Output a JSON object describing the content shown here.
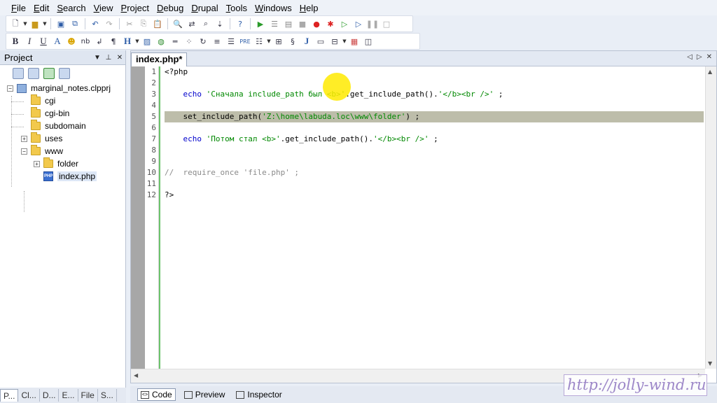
{
  "menu": [
    {
      "key": "F",
      "rest": "ile"
    },
    {
      "key": "E",
      "rest": "dit"
    },
    {
      "key": "S",
      "rest": "earch"
    },
    {
      "key": "V",
      "rest": "iew"
    },
    {
      "key": "P",
      "rest": "roject"
    },
    {
      "key": "D",
      "rest": "ebug"
    },
    {
      "key": "D",
      "rest": "rupal"
    },
    {
      "key": "T",
      "rest": "ools"
    },
    {
      "key": "W",
      "rest": "indows"
    },
    {
      "key": "H",
      "rest": "elp"
    }
  ],
  "toolbar2": {
    "bold": "B",
    "italic": "I",
    "underline": "U",
    "anchor": "A",
    "nbsp": "nb",
    "para": "¶",
    "heading": "H",
    "pre": "PRE",
    "code": "J"
  },
  "project_panel": {
    "title": "Project",
    "tree": {
      "project": "marginal_notes.clpprj",
      "cgi": "cgi",
      "cgi_bin": "cgi-bin",
      "subdomain": "subdomain",
      "uses": "uses",
      "www": "www",
      "folder": "folder",
      "index": "index.php"
    }
  },
  "left_tabs": [
    "P...",
    "Cl...",
    "D...",
    "E...",
    "File",
    "S..."
  ],
  "editor": {
    "tab_title": "index.php*",
    "line_numbers": [
      "1",
      "2",
      "3",
      "4",
      "5",
      "6",
      "7",
      "8",
      "9",
      "10",
      "11",
      "12"
    ],
    "lines": {
      "l1": "<?php",
      "l3_kw": "echo",
      "l3_str1": "'Сначала include_path был <b>'",
      "l3_fn": ".get_include_path().",
      "l3_str2": "'</b><br />'",
      "l3_end": " ;",
      "l5_fn": "set_include_path(",
      "l5_str": "'Z:\\home\\labuda.loc\\www\\folder'",
      "l5_end": ") ;",
      "l7_kw": "echo",
      "l7_str1": "'Потом стал <b>'",
      "l7_fn": ".get_include_path().",
      "l7_str2": "'</b><br />'",
      "l7_end": " ;",
      "l10": "//  require_once 'file.php' ;",
      "l12": "?>"
    }
  },
  "bottom_tabs": {
    "code": "Code",
    "preview": "Preview",
    "inspector": "Inspector"
  },
  "watermark": "http://jolly-wind.ru",
  "colors": {
    "keyword": "#0000cc",
    "string": "#008800",
    "comment": "#8a8a8a",
    "highlight": "#bdbdaa"
  }
}
